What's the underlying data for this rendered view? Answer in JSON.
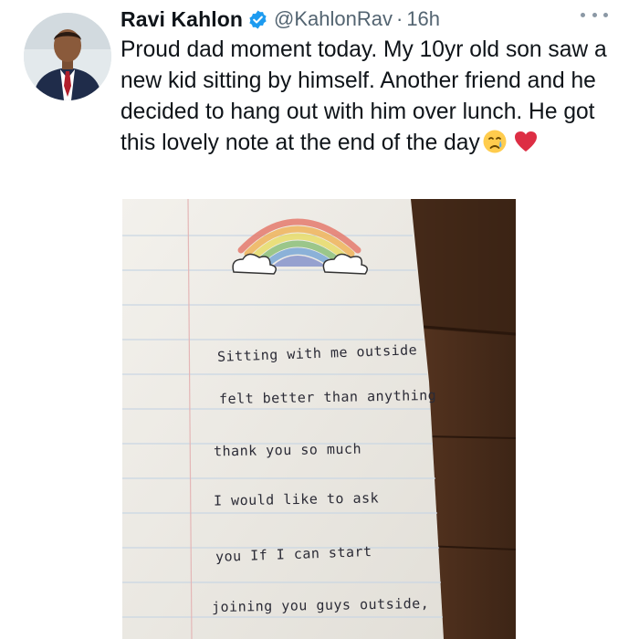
{
  "tweet": {
    "author_name": "Ravi Kahlon",
    "handle": "@KahlonRav",
    "separator": "·",
    "time": "16h",
    "body": "Proud dad moment today. My 10yr old son saw a new kid sitting by himself. Another friend and he decided to hang out with him over lunch. He got this lovely note at the end of the day",
    "emojis": [
      "crying-face-icon",
      "red-heart-icon"
    ]
  },
  "note": {
    "lines": [
      "Sitting with me outside",
      "felt better than anything",
      "thank you so much",
      "I would like to ask",
      "you If I can start",
      "joining you guys outside,"
    ]
  },
  "colors": {
    "verified_badge": "#1d9bf0",
    "muted_text": "#536471",
    "heart": "#e0245e"
  }
}
